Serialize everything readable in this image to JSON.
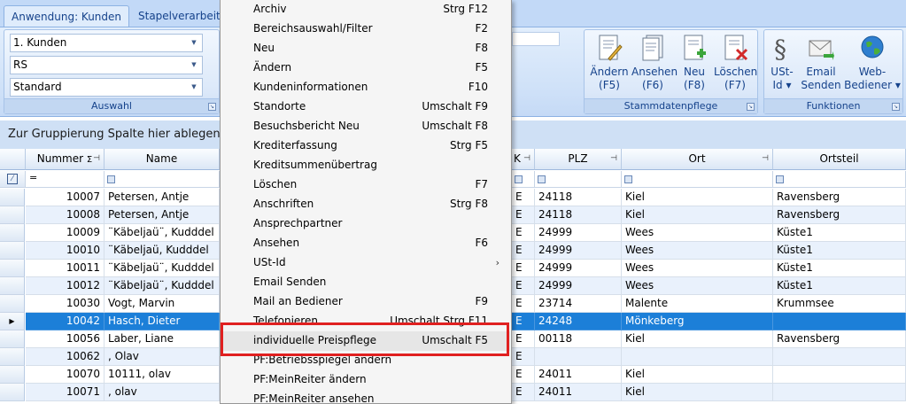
{
  "ribbon": {
    "tabs": [
      "Anwendung: Kunden",
      "Stapelverarbeitung"
    ],
    "auswahl": {
      "combos": [
        "1. Kunden",
        "RS",
        "Standard"
      ],
      "title": "Auswahl"
    },
    "stammdaten": {
      "title": "Stammdatenpflege",
      "buttons": [
        {
          "label": "Ändern\n(F5)",
          "icon": "edit-document-icon"
        },
        {
          "label": "Ansehen\n(F6)",
          "icon": "view-document-icon"
        },
        {
          "label": "Neu\n(F8)",
          "icon": "new-document-icon"
        },
        {
          "label": "Löschen\n(F7)",
          "icon": "delete-document-icon"
        }
      ]
    },
    "funktionen": {
      "title": "Funktionen",
      "buttons": [
        {
          "label": "USt-\nId ▾",
          "icon": "paragraph-icon"
        },
        {
          "label": "Email\nSenden",
          "icon": "email-icon"
        },
        {
          "label": "Web-\nBediener ▾",
          "icon": "globe-icon"
        }
      ]
    }
  },
  "group_panel": {
    "text": "Zur Gruppierung Spalte hier ablegen"
  },
  "grid": {
    "columns": {
      "nummer": "Nummer",
      "name": "Name",
      "k": "K",
      "plz": "PLZ",
      "ort": "Ort",
      "ortsteil": "Ortsteil"
    },
    "filter_eq": "=",
    "rows": [
      {
        "nummer": "10007",
        "name": "Petersen, Antje",
        "k": "E",
        "plz": "24118",
        "ort": "Kiel",
        "ortsteil": "Ravensberg"
      },
      {
        "nummer": "10008",
        "name": "Petersen, Antje",
        "k": "E",
        "plz": "24118",
        "ort": "Kiel",
        "ortsteil": "Ravensberg"
      },
      {
        "nummer": "10009",
        "name": "¨Käbeljaü¨, Kudddel",
        "k": "E",
        "plz": "24999",
        "ort": "Wees",
        "ortsteil": "Küste1"
      },
      {
        "nummer": "10010",
        "name": "¨Käbeljaü, Kudddel",
        "k": "E",
        "plz": "24999",
        "ort": "Wees",
        "ortsteil": "Küste1"
      },
      {
        "nummer": "10011",
        "name": "¨Käbeljaü¨, Kudddel",
        "k": "E",
        "plz": "24999",
        "ort": "Wees",
        "ortsteil": "Küste1"
      },
      {
        "nummer": "10012",
        "name": "¨Käbeljaü¨, Kudddel",
        "k": "E",
        "plz": "24999",
        "ort": "Wees",
        "ortsteil": "Küste1"
      },
      {
        "nummer": "10030",
        "name": "Vogt, Marvin",
        "k": "E",
        "plz": "23714",
        "ort": "Malente",
        "ortsteil": "Krummsee"
      },
      {
        "nummer": "10042",
        "name": "Hasch, Dieter",
        "k": "E",
        "plz": "24248",
        "ort": "Mönkeberg",
        "ortsteil": ""
      },
      {
        "nummer": "10056",
        "name": "Laber, Liane",
        "k": "E",
        "plz": "00118",
        "ort": "Kiel",
        "ortsteil": "Ravensberg"
      },
      {
        "nummer": "10062",
        "name": ", Olav",
        "k": "E",
        "plz": "",
        "ort": "",
        "ortsteil": ""
      },
      {
        "nummer": "10070",
        "name": "10111, olav",
        "k": "E",
        "plz": "24011",
        "ort": "Kiel",
        "ortsteil": ""
      },
      {
        "nummer": "10071",
        "name": ", olav",
        "k": "E",
        "plz": "24011",
        "ort": "Kiel",
        "ortsteil": ""
      }
    ],
    "selected_row_marker": "▶"
  },
  "context_menu": {
    "items": [
      {
        "label": "Archiv",
        "shortcut": "Strg F12"
      },
      {
        "label": "Bereichsauswahl/Filter",
        "shortcut": "F2"
      },
      {
        "label": "Neu",
        "shortcut": "F8"
      },
      {
        "label": "Ändern",
        "shortcut": "F5"
      },
      {
        "label": "Kundeninformationen",
        "shortcut": "F10"
      },
      {
        "label": "Standorte",
        "shortcut": "Umschalt F9"
      },
      {
        "label": "Besuchsbericht Neu",
        "shortcut": "Umschalt F8"
      },
      {
        "label": "Krediterfassung",
        "shortcut": "Strg F5"
      },
      {
        "label": "Kreditsummenübertrag",
        "shortcut": ""
      },
      {
        "label": "Löschen",
        "shortcut": "F7"
      },
      {
        "label": "Anschriften",
        "shortcut": "Strg F8"
      },
      {
        "label": "Ansprechpartner",
        "shortcut": ""
      },
      {
        "label": "Ansehen",
        "shortcut": "F6"
      },
      {
        "label": "USt-Id",
        "shortcut": "",
        "submenu": "›"
      },
      {
        "label": "Email Senden",
        "shortcut": ""
      },
      {
        "label": "Mail an Bediener",
        "shortcut": "F9"
      },
      {
        "label": "Telefonieren",
        "shortcut": "Umschalt Strg F11"
      },
      {
        "label": "individuelle Preispflege",
        "shortcut": "Umschalt F5"
      },
      {
        "label": "PF:Betriebsspiegel ändern",
        "shortcut": ""
      },
      {
        "label": "PF:MeinReiter ändern",
        "shortcut": ""
      },
      {
        "label": "PF:MeinReiter ansehen",
        "shortcut": ""
      }
    ],
    "highlighted_index": 17
  },
  "colors": {
    "selection": "#1c7fd8",
    "highlight_box": "#e02020"
  }
}
